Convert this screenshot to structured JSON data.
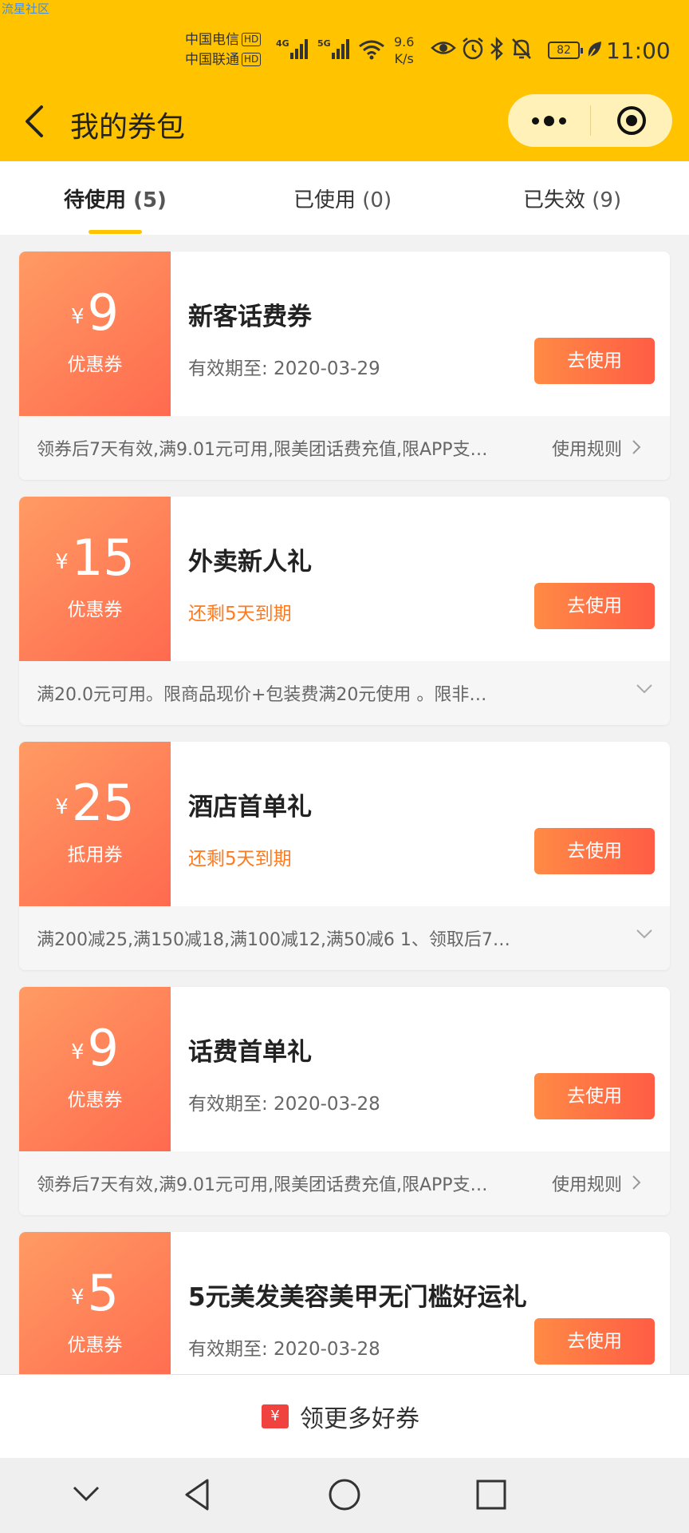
{
  "watermark": "流星社区",
  "status_bar": {
    "carrier1": "中国电信",
    "carrier2": "中国联通",
    "hd": "HD",
    "sig1_label": "4G",
    "sig2_label": "5G",
    "speed_value": "9.6",
    "speed_unit": "K/s",
    "battery": "82",
    "time": "11:00"
  },
  "header": {
    "title": "我的券包"
  },
  "tabs": [
    {
      "label": "待使用",
      "count": "(5)"
    },
    {
      "label": "已使用",
      "count": "(0)"
    },
    {
      "label": "已失效",
      "count": "(9)"
    }
  ],
  "currency": "¥",
  "use_button_label": "去使用",
  "coupons": [
    {
      "amount": "9",
      "type": "优惠券",
      "title": "新客话费券",
      "subtitle": "有效期至: 2020-03-29",
      "rule": "领券后7天有效,满9.01元可用,限美团话费充值,限APP支…",
      "rule_link": "使用规则"
    },
    {
      "amount": "15",
      "type": "优惠券",
      "title": "外卖新人礼",
      "subtitle": "还剩5天到期",
      "rule": "满20.0元可用。限商品现价+包装费满20元使用 。限非…"
    },
    {
      "amount": "25",
      "type": "抵用券",
      "title": "酒店首单礼",
      "subtitle": "还剩5天到期",
      "rule": "满200减25,满150减18,满100减12,满50减6 1、领取后7…"
    },
    {
      "amount": "9",
      "type": "优惠券",
      "title": "话费首单礼",
      "subtitle": "有效期至: 2020-03-28",
      "rule": "领券后7天有效,满9.01元可用,限美团话费充值,限APP支…",
      "rule_link": "使用规则"
    },
    {
      "amount": "5",
      "type": "优惠券",
      "title": "5元美发美容美甲无门槛好运礼",
      "subtitle": "有效期至: 2020-03-28"
    }
  ],
  "bottom": {
    "icon_text": "¥",
    "label": "领更多好券"
  },
  "colors": {
    "brand_yellow": "#ffc300",
    "coupon_orange": "#ff7a4f",
    "warn_orange": "#ff7a1e"
  }
}
